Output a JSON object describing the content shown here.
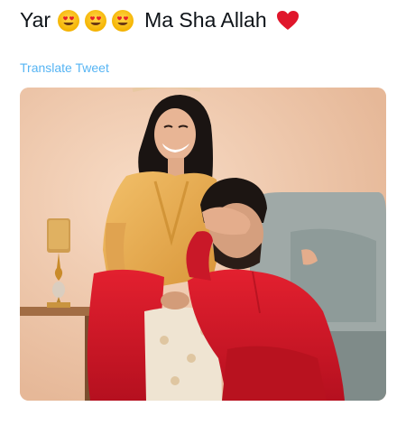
{
  "tweet": {
    "text_parts": [
      "Yar",
      "Ma Sha Allah"
    ],
    "emojis": [
      "heart-eyes-emoji",
      "heart-eyes-emoji",
      "heart-eyes-emoji",
      "red-heart-emoji"
    ],
    "translate_label": "Translate Tweet"
  },
  "media": {
    "description": "photo-of-couple",
    "colors": {
      "background": "#efc7ab",
      "outfit_red": "#d8182a",
      "outfit_gold": "#e8a94a",
      "sofa": "#9aa6a4"
    }
  }
}
